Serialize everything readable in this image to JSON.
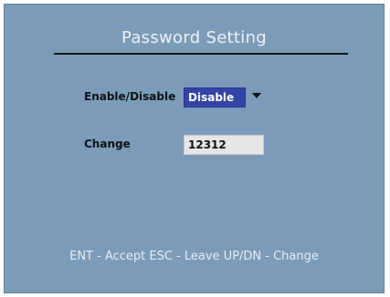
{
  "dialog": {
    "title": "Password Setting"
  },
  "enable_row": {
    "label": "Enable/Disable",
    "selected": "Disable"
  },
  "change_row": {
    "label": "Change",
    "value": "12312"
  },
  "footer": {
    "help": "ENT - Accept ESC - Leave UP/DN - Change"
  },
  "colors": {
    "panel_bg": "#7a9cb8",
    "select_bg": "#3344a6",
    "input_bg": "#e6e6e6"
  },
  "icons": {
    "dropdown": "chevron-down-icon"
  }
}
